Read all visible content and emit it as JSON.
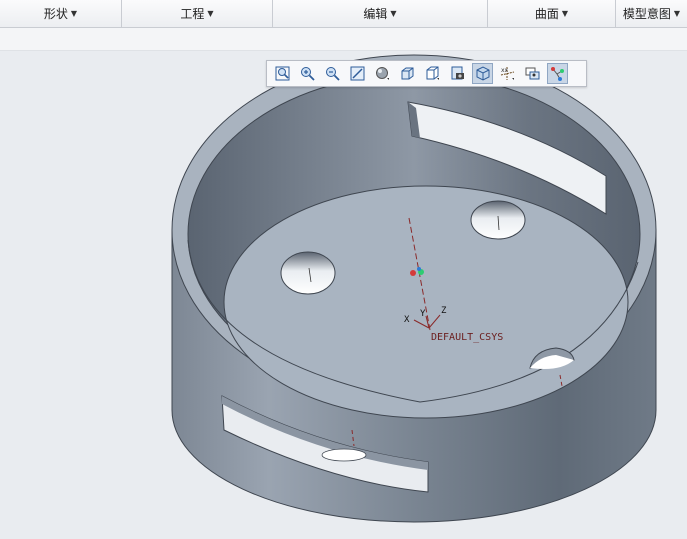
{
  "menus": [
    {
      "label": "形状",
      "icon": "dropdown-arrow-icon"
    },
    {
      "label": "工程",
      "icon": "dropdown-arrow-icon"
    },
    {
      "label": "编辑",
      "icon": "dropdown-arrow-icon"
    },
    {
      "label": "曲面",
      "icon": "dropdown-arrow-icon"
    },
    {
      "label": "模型意图",
      "icon": "dropdown-arrow-icon"
    }
  ],
  "toolbar": {
    "buttons": [
      {
        "name": "refit-zoom-icon"
      },
      {
        "name": "zoom-in-icon"
      },
      {
        "name": "zoom-out-icon"
      },
      {
        "name": "repaint-icon"
      },
      {
        "name": "shading-style-icon"
      },
      {
        "name": "named-views-icon"
      },
      {
        "name": "saved-orientations-icon"
      },
      {
        "name": "view-manager-icon"
      },
      {
        "name": "perspective-view-icon",
        "active": true
      },
      {
        "name": "datum-display-icon"
      },
      {
        "name": "spin-center-icon"
      },
      {
        "name": "annotation-display-icon"
      }
    ]
  },
  "model": {
    "csys_label": "DEFAULT_CSYS",
    "axis_x": "X",
    "axis_y": "Y",
    "axis_z": "Z"
  }
}
